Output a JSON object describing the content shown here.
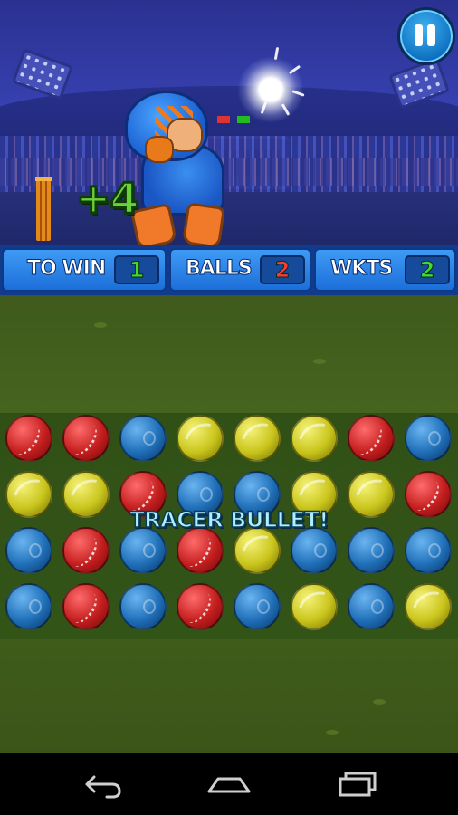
{
  "scene": {
    "score_popup": "+4"
  },
  "status_bar": {
    "to_win": {
      "label": "TO WIN",
      "value": "1",
      "value_color": "#3ddc2f"
    },
    "balls": {
      "label": "BALLS",
      "value": "2",
      "value_color": "#ff3b2f"
    },
    "wickets": {
      "label": "WKTS",
      "value": "2",
      "value_color": "#3ddc2f"
    }
  },
  "board": {
    "rows": [
      [
        "red",
        "red",
        "blue",
        "yellow",
        "yellow",
        "yellow",
        "red",
        "blue"
      ],
      [
        "yellow",
        "yellow",
        "red",
        "blue",
        "blue",
        "yellow",
        "yellow",
        "red"
      ],
      [
        "blue",
        "red",
        "blue",
        "red",
        "yellow",
        "blue",
        "blue",
        "blue"
      ],
      [
        "blue",
        "red",
        "blue",
        "red",
        "blue",
        "yellow",
        "blue",
        "yellow"
      ]
    ],
    "message": "TRACER BULLET!"
  },
  "colors": {
    "panel_blue": "#1c6fd9",
    "field_green": "#3f5a1c",
    "pause_blue": "#0d6fbf"
  },
  "icons": {
    "pause": "pause-icon",
    "nav_back": "back-arrow-icon",
    "nav_home": "home-icon",
    "nav_recent": "recent-apps-icon"
  }
}
